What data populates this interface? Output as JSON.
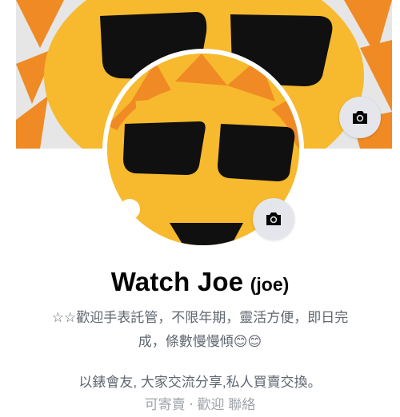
{
  "profile": {
    "name": "Watch Joe",
    "alternate_name": "(joe)",
    "bio_line_1": "☆☆歡迎手表託管，不限年期，靈活方便，即日完",
    "bio_line_2": "成，條數慢慢傾😊😊",
    "bio_line_3": "以錶會友, 大家交流分享,私人買賣交換。",
    "bio_line_4": "可寄賣 ‧ 歡迎 聯絡",
    "cover_camera_icon": "camera-icon",
    "avatar_camera_icon": "camera-icon"
  },
  "colors": {
    "sun_yellow": "#f7b92d",
    "sun_orange": "#f08a24",
    "glasses_black": "#101010",
    "button_gray": "#e4e6eb"
  }
}
